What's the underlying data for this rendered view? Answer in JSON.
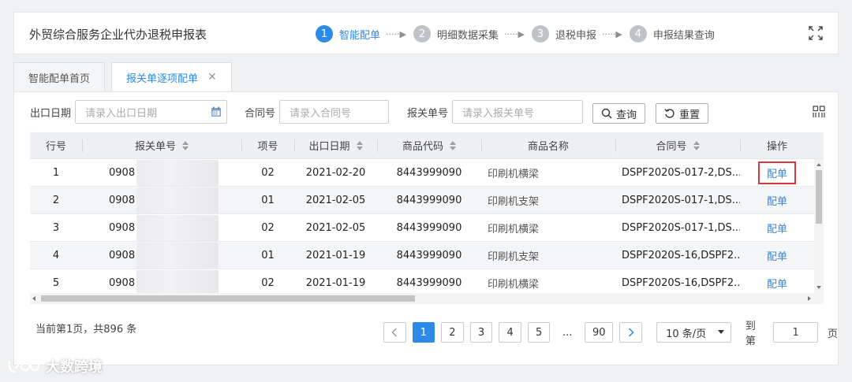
{
  "header": {
    "title": "外贸综合服务企业代办退税申报表",
    "steps": [
      {
        "num": "1",
        "label": "智能配单"
      },
      {
        "num": "2",
        "label": "明细数据采集"
      },
      {
        "num": "3",
        "label": "退税申报"
      },
      {
        "num": "4",
        "label": "申报结果查询"
      }
    ],
    "step_separator": "·····▶"
  },
  "tabs": [
    {
      "label": "智能配单首页"
    },
    {
      "label": "报关单逐项配单",
      "close": "✕"
    }
  ],
  "filters": {
    "export_date": {
      "label": "出口日期",
      "placeholder": "请录入出口日期"
    },
    "contract_no": {
      "label": "合同号",
      "placeholder": "请录入合同号"
    },
    "customs_no": {
      "label": "报关单号",
      "placeholder": "请录入报关单号"
    },
    "search_label": "查询",
    "reset_label": "重置"
  },
  "table": {
    "columns": [
      "行号",
      "报关单号",
      "项号",
      "出口日期",
      "商品代码",
      "商品名称",
      "合同号",
      "操作"
    ],
    "rows": [
      {
        "row": "1",
        "customs_no": "0908",
        "item": "02",
        "date": "2021-02-20",
        "code": "8443999090",
        "name": "印刷机横梁",
        "contract": "DSPF2020S-017-2,DS...",
        "op": "配单"
      },
      {
        "row": "2",
        "customs_no": "0908",
        "item": "01",
        "date": "2021-02-05",
        "code": "8443999090",
        "name": "印刷机支架",
        "contract": "DSPF2020S-017-1,DS...",
        "op": "配单"
      },
      {
        "row": "3",
        "customs_no": "0908",
        "item": "02",
        "date": "2021-02-05",
        "code": "8443999090",
        "name": "印刷机横梁",
        "contract": "DSPF2020S-017-1,DS...",
        "op": "配单"
      },
      {
        "row": "4",
        "customs_no": "0908",
        "item": "01",
        "date": "2021-01-19",
        "code": "8443999090",
        "name": "印刷机支架",
        "contract": "DSPF2020S-16,DSPF2...",
        "op": "配单"
      },
      {
        "row": "5",
        "customs_no": "0908",
        "item": "02",
        "date": "2021-01-19",
        "code": "8443999090",
        "name": "印刷机横梁",
        "contract": "DSPF2020S-16,DSPF2...",
        "op": "配单"
      }
    ]
  },
  "pagination": {
    "info": "当前第1页，共896 条",
    "pages": [
      "1",
      "2",
      "3",
      "4",
      "5"
    ],
    "ellipsis": "...",
    "last_page": "90",
    "page_size": "10 条/页",
    "goto_label": "到第",
    "goto_value": "1",
    "goto_suffix": "页"
  },
  "watermark": {
    "text": "大数跨境"
  },
  "colors": {
    "accent": "#2d8ae6",
    "highlight": "#d9363e"
  }
}
